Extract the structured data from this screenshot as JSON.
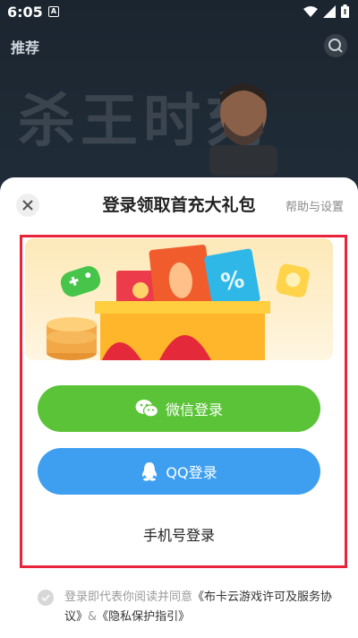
{
  "status_bar": {
    "time": "6:05",
    "notif_letter": "A",
    "icons": [
      "wifi-icon",
      "signal-icon",
      "battery-icon"
    ]
  },
  "app": {
    "tab_title": "推荐",
    "search_icon": "search-icon"
  },
  "banner": {
    "background_text": "杀王时刻"
  },
  "sheet": {
    "title": "登录领取首充大礼包",
    "help_label": "帮助与设置",
    "close_icon": "close-icon"
  },
  "login": {
    "wechat_label": "微信登录",
    "qq_label": "QQ登录",
    "phone_label": "手机号登录"
  },
  "agreement": {
    "prefix": "登录即代表你阅读并同意",
    "terms": "《布卡云游戏许可及服务协议》",
    "joiner": "&",
    "privacy": "《隐私保护指引》"
  },
  "colors": {
    "wechat": "#5ac337",
    "qq": "#3e9ff0",
    "highlight": "#e8243a"
  }
}
